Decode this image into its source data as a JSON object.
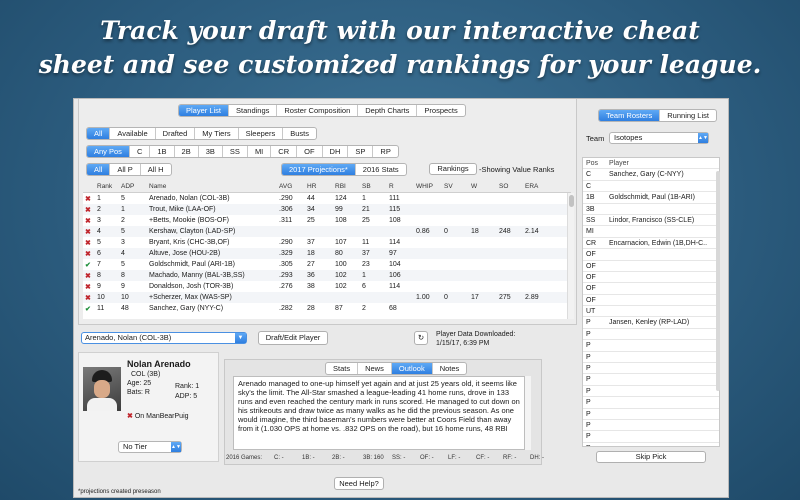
{
  "headline": {
    "line1": "Track your draft with our interactive cheat",
    "line2": "sheet and see customized rankings for your league."
  },
  "tabs": [
    "Player List",
    "Standings",
    "Roster Composition",
    "Depth Charts",
    "Prospects"
  ],
  "filters": [
    "All",
    "Available",
    "Drafted",
    "My Tiers",
    "Sleepers",
    "Busts"
  ],
  "positions": [
    "Any Pos",
    "C",
    "1B",
    "2B",
    "3B",
    "SS",
    "MI",
    "CR",
    "OF",
    "DH",
    "SP",
    "RP"
  ],
  "player_types": [
    "All",
    "All P",
    "All H"
  ],
  "stat_sources": [
    "2017 Projections*",
    "2016 Stats"
  ],
  "rankings_button": "Rankings",
  "showing_text": "-Showing Value Ranks",
  "columns": [
    "Rank",
    "ADP",
    "Name",
    "AVG",
    "HR",
    "RBI",
    "SB",
    "R",
    "WHIP",
    "SV",
    "W",
    "SO",
    "ERA"
  ],
  "players": [
    {
      "mark": "✖",
      "rank": "1",
      "adp": "5",
      "name": "Arenado, Nolan (COL-3B)",
      "avg": ".290",
      "hr": "44",
      "rbi": "124",
      "sb": "1",
      "r": "111",
      "whip": "",
      "sv": "",
      "w": "",
      "so": "",
      "era": ""
    },
    {
      "mark": "✖",
      "rank": "2",
      "adp": "1",
      "name": "Trout, Mike (LAA-OF)",
      "avg": ".306",
      "hr": "34",
      "rbi": "99",
      "sb": "21",
      "r": "115",
      "whip": "",
      "sv": "",
      "w": "",
      "so": "",
      "era": ""
    },
    {
      "mark": "✖",
      "rank": "3",
      "adp": "2",
      "name": "+Betts, Mookie (BOS-OF)",
      "avg": ".311",
      "hr": "25",
      "rbi": "108",
      "sb": "25",
      "r": "108",
      "whip": "",
      "sv": "",
      "w": "",
      "so": "",
      "era": ""
    },
    {
      "mark": "✖",
      "rank": "4",
      "adp": "5",
      "name": "Kershaw, Clayton (LAD-SP)",
      "avg": "",
      "hr": "",
      "rbi": "",
      "sb": "",
      "r": "",
      "whip": "0.86",
      "sv": "0",
      "w": "18",
      "so": "248",
      "era": "2.14"
    },
    {
      "mark": "✖",
      "rank": "5",
      "adp": "3",
      "name": "Bryant, Kris (CHC-3B,OF)",
      "avg": ".290",
      "hr": "37",
      "rbi": "107",
      "sb": "11",
      "r": "114",
      "whip": "",
      "sv": "",
      "w": "",
      "so": "",
      "era": ""
    },
    {
      "mark": "✖",
      "rank": "6",
      "adp": "4",
      "name": "Altuve, Jose (HOU-2B)",
      "avg": ".329",
      "hr": "18",
      "rbi": "80",
      "sb": "37",
      "r": "97",
      "whip": "",
      "sv": "",
      "w": "",
      "so": "",
      "era": ""
    },
    {
      "mark": "✔",
      "rank": "7",
      "adp": "5",
      "name": "Goldschmidt, Paul (ARI-1B)",
      "avg": ".305",
      "hr": "27",
      "rbi": "100",
      "sb": "23",
      "r": "104",
      "whip": "",
      "sv": "",
      "w": "",
      "so": "",
      "era": ""
    },
    {
      "mark": "✖",
      "rank": "8",
      "adp": "8",
      "name": "Machado, Manny (BAL-3B,SS)",
      "avg": ".293",
      "hr": "36",
      "rbi": "102",
      "sb": "1",
      "r": "106",
      "whip": "",
      "sv": "",
      "w": "",
      "so": "",
      "era": ""
    },
    {
      "mark": "✖",
      "rank": "9",
      "adp": "9",
      "name": "Donaldson, Josh (TOR-3B)",
      "avg": ".276",
      "hr": "38",
      "rbi": "102",
      "sb": "6",
      "r": "114",
      "whip": "",
      "sv": "",
      "w": "",
      "so": "",
      "era": ""
    },
    {
      "mark": "✖",
      "rank": "10",
      "adp": "10",
      "name": "+Scherzer, Max (WAS-SP)",
      "avg": "",
      "hr": "",
      "rbi": "",
      "sb": "",
      "r": "",
      "whip": "1.00",
      "sv": "0",
      "w": "17",
      "so": "275",
      "era": "2.89"
    },
    {
      "mark": "✔",
      "rank": "11",
      "adp": "48",
      "name": "Sanchez, Gary (NYY-C)",
      "avg": ".282",
      "hr": "28",
      "rbi": "87",
      "sb": "2",
      "r": "68",
      "whip": "",
      "sv": "",
      "w": "",
      "so": "",
      "era": ""
    }
  ],
  "selected_player_label": "Arenado, Nolan (COL-3B)",
  "draft_edit_button": "Draft/Edit Player",
  "download_info": {
    "label": "Player Data Downloaded:",
    "date": "1/15/17, 6:39 PM"
  },
  "player_card": {
    "name": "Nolan Arenado",
    "team_pos": "COL (3B)",
    "age": "Age: 25",
    "bats": "Bats: R",
    "rank": "Rank: 1",
    "adp": "ADP: 5",
    "drafted_by": "On ManBearPuig",
    "tier": "No Tier"
  },
  "detail_tabs": [
    "Stats",
    "News",
    "Outlook",
    "Notes"
  ],
  "outlook_text": "Arenado managed to one-up himself yet again and at just 25 years old, it seems like sky's the limit. The All-Star smashed a league-leading 41 home runs, drove in 133 runs and even reached the century mark in runs scored. He managed to cut down on his strikeouts and draw twice as many walks as he did the previous season. As one would imagine, the third baseman's numbers were better at Coors Field than away from it (1.030 OPS at home vs. .832 OPS on the road), but 16 home runs, 48 RBI",
  "games_2016": {
    "label": "2016 Games:",
    "items": [
      "C: -",
      "1B: -",
      "2B: -",
      "3B: 160",
      "SS: -",
      "OF: -",
      "LF: -",
      "CF: -",
      "RF: -",
      "DH: -"
    ]
  },
  "need_help": "Need Help?",
  "footnote": "*projections created preseason",
  "side": {
    "tabs": [
      "Team Rosters",
      "Running List"
    ],
    "team_label": "Team",
    "team_value": "Isotopes",
    "columns": [
      "Pos",
      "Player"
    ],
    "roster": [
      {
        "pos": "C",
        "player": "Sanchez, Gary (C-NYY)"
      },
      {
        "pos": "C",
        "player": ""
      },
      {
        "pos": "1B",
        "player": "Goldschmidt, Paul (1B-ARI)"
      },
      {
        "pos": "3B",
        "player": ""
      },
      {
        "pos": "SS",
        "player": "Lindor, Francisco (SS-CLE)"
      },
      {
        "pos": "MI",
        "player": ""
      },
      {
        "pos": "CR",
        "player": "Encarnacion, Edwin (1B,DH-C.."
      },
      {
        "pos": "OF",
        "player": ""
      },
      {
        "pos": "OF",
        "player": ""
      },
      {
        "pos": "OF",
        "player": ""
      },
      {
        "pos": "OF",
        "player": ""
      },
      {
        "pos": "OF",
        "player": ""
      },
      {
        "pos": "UT",
        "player": ""
      },
      {
        "pos": "P",
        "player": "Jansen, Kenley (RP-LAD)"
      },
      {
        "pos": "P",
        "player": ""
      },
      {
        "pos": "P",
        "player": ""
      },
      {
        "pos": "P",
        "player": ""
      },
      {
        "pos": "P",
        "player": ""
      },
      {
        "pos": "P",
        "player": ""
      },
      {
        "pos": "P",
        "player": ""
      },
      {
        "pos": "P",
        "player": ""
      },
      {
        "pos": "P",
        "player": ""
      },
      {
        "pos": "P",
        "player": ""
      },
      {
        "pos": "P",
        "player": ""
      },
      {
        "pos": "P",
        "player": ""
      }
    ],
    "skip_pick": "Skip Pick"
  },
  "colors": {
    "accent": "#2f7fe0",
    "x_mark": "#c0262d",
    "check_mark": "#1f8f3a",
    "background": "#2b5b7d"
  }
}
